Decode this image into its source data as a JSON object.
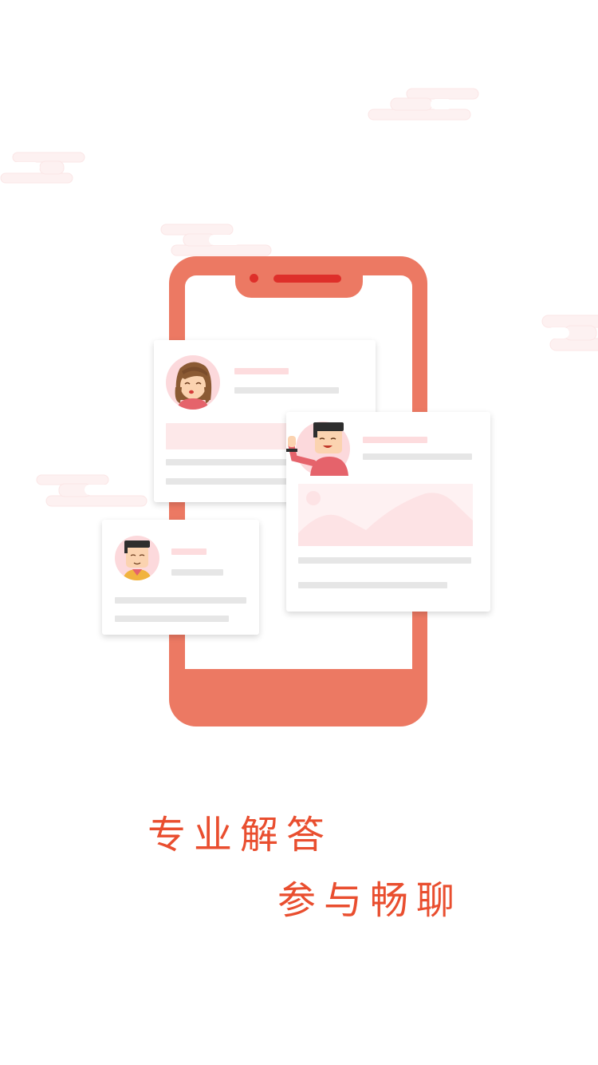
{
  "slogan": {
    "line1": "专业解答",
    "line2": "参与畅聊"
  },
  "illustration": {
    "phone_color": "#ec7963",
    "accent_color": "#e94e2f",
    "placeholder_pink": "#fddcde",
    "placeholder_grey": "#e6e6e6",
    "cards": [
      {
        "avatar": "woman-avatar-icon"
      },
      {
        "avatar": "waving-man-avatar-icon",
        "image": "image-placeholder-icon"
      },
      {
        "avatar": "boy-avatar-icon"
      }
    ]
  }
}
